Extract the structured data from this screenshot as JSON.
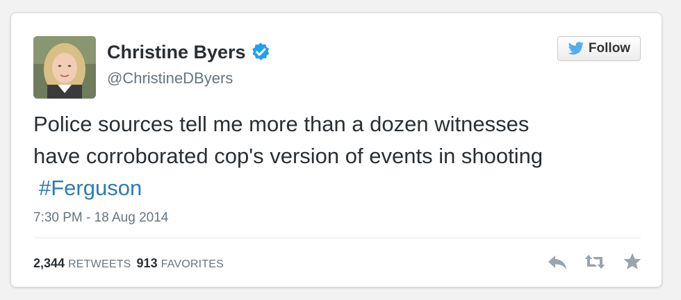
{
  "author": {
    "name": "Christine Byers",
    "handle": "@ChristineDByers",
    "verified": true
  },
  "follow_button": {
    "label": "Follow",
    "icon": "twitter-bird-icon"
  },
  "tweet": {
    "text_line1": "Police sources tell me more than a dozen witnesses",
    "text_line2": "have corroborated cop's version of events in shooting",
    "hashtag": "#Ferguson",
    "timestamp": "7:30 PM - 18 Aug 2014"
  },
  "stats": {
    "retweets_count": "2,344",
    "retweets_label": "RETWEETS",
    "favorites_count": "913",
    "favorites_label": "FAVORITES"
  },
  "actions": [
    "reply-icon",
    "retweet-icon",
    "favorite-icon"
  ],
  "colors": {
    "hashtag": "#2b7bb9",
    "verified": "#1da1f2",
    "text": "#292f33",
    "muted": "#66757f",
    "action_icons": "#9aa4ad"
  }
}
